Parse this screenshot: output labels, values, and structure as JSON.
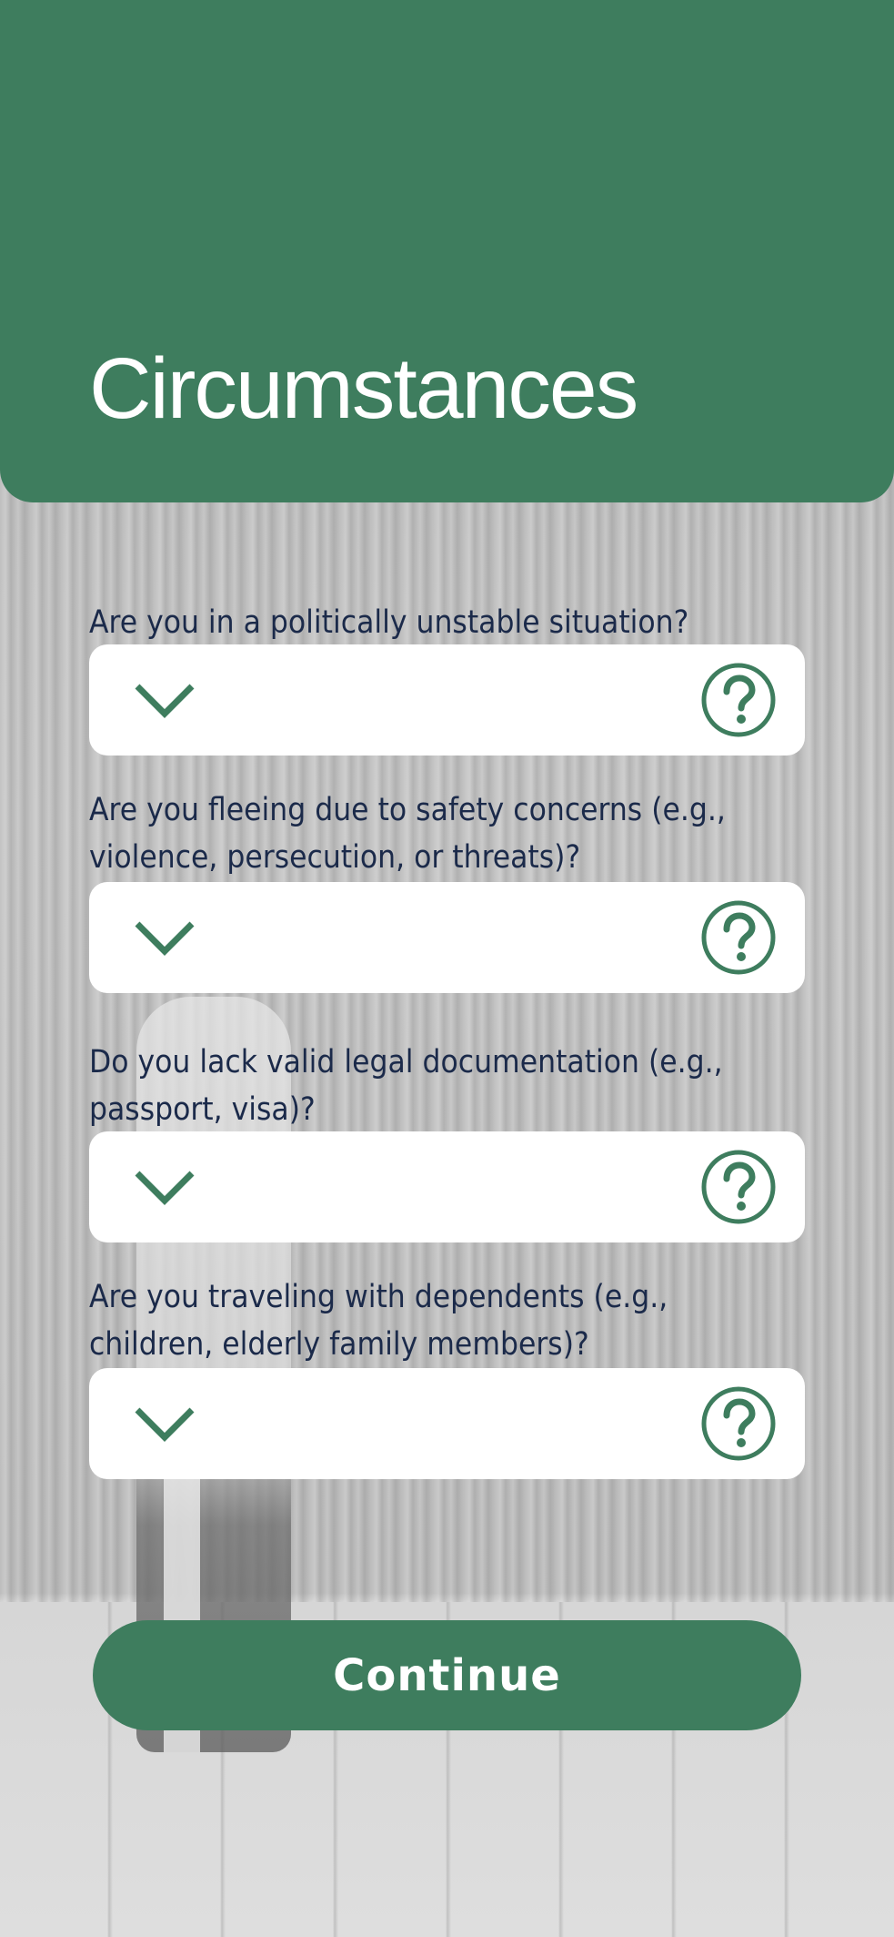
{
  "header": {
    "title": "Circumstances"
  },
  "questions": [
    {
      "label": "Are you in a politically unstable situation?",
      "chevron_icon": "chevron-down-icon",
      "help_icon": "help-circle-icon"
    },
    {
      "label": "Are you fleeing due to safety concerns (e.g., violence, persecution, or threats)?",
      "chevron_icon": "chevron-down-icon",
      "help_icon": "help-circle-icon"
    },
    {
      "label": "Do you lack valid legal documentation (e.g., passport, visa)?",
      "chevron_icon": "chevron-down-icon",
      "help_icon": "help-circle-icon"
    },
    {
      "label": "Are you traveling with dependents (e.g., children, elderly family members)?",
      "chevron_icon": "chevron-down-icon",
      "help_icon": "help-circle-icon"
    }
  ],
  "continue_button": {
    "label": "Continue"
  },
  "colors": {
    "brand_green": "#3e7d5e",
    "question_text": "#1b2a4a",
    "field_background": "#ffffff"
  }
}
